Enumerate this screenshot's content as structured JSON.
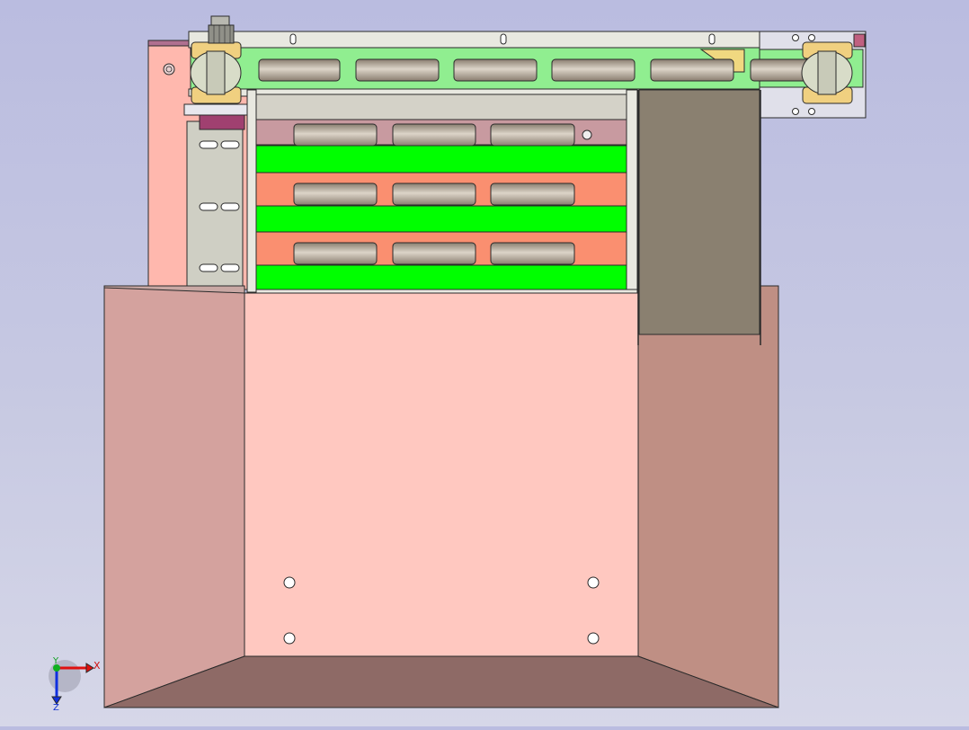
{
  "view": {
    "background_top": "#babce0",
    "background_bottom": "#d6d7e8"
  },
  "triad": {
    "x_label": "X",
    "y_label": "Y",
    "z_label": "Z",
    "x_color": "#e01010",
    "y_color": "#10b020",
    "z_color": "#1030e0"
  },
  "colors": {
    "edge": "#2a2a2a",
    "bin_front": "#ffc8c0",
    "bin_left": "#d4a29e",
    "bin_right": "#bf8f84",
    "bin_bottom": "#8e6a66",
    "rack_fill": "#ffb8ae",
    "green_plate": "#00ff00",
    "light_green": "#90ee90",
    "salmon_plate": "#fa8f70",
    "roller_light": "#dcd4c8",
    "roller_dark": "#8a7e70",
    "guard_grey": "#8a8070",
    "bracket_grey": "#cfcfc4",
    "brass": "#f0d080",
    "magenta_block": "#a04070",
    "frame_light": "#e8e8e0"
  }
}
